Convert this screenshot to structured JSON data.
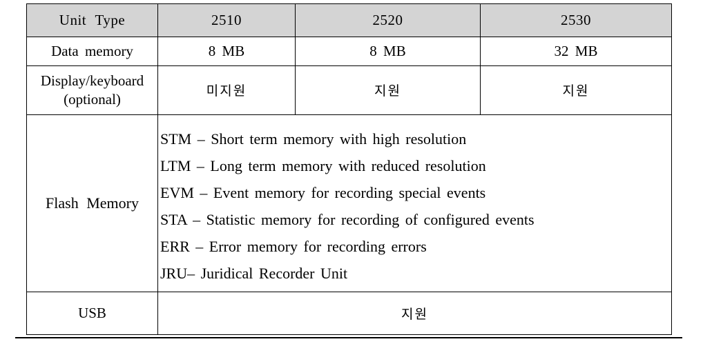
{
  "table": {
    "columns": [
      "Unit Type",
      "2510",
      "2520",
      "2530"
    ],
    "rows": [
      {
        "label": "Data memory",
        "type": "values",
        "values": [
          "8 MB",
          "8 MB",
          "32 MB"
        ]
      },
      {
        "label_line1": "Display/keyboard",
        "label_line2": "(optional)",
        "type": "values-korean",
        "values": [
          "미지원",
          "지원",
          "지원"
        ]
      },
      {
        "label": "Flash Memory",
        "type": "list",
        "items": [
          "STM – Short term memory with high resolution",
          "LTM – Long term memory with reduced resolution",
          "EVM – Event memory for recording special events",
          "STA – Statistic memory for recording of configured events",
          "ERR – Error memory for recording errors",
          "JRU– Juridical Recorder Unit"
        ]
      },
      {
        "label": "USB",
        "type": "merged",
        "value": "지원"
      }
    ]
  },
  "style": {
    "header_background": "#d4d4d4",
    "border_color": "#000000",
    "text_color": "#000000",
    "page_background": "#ffffff"
  }
}
